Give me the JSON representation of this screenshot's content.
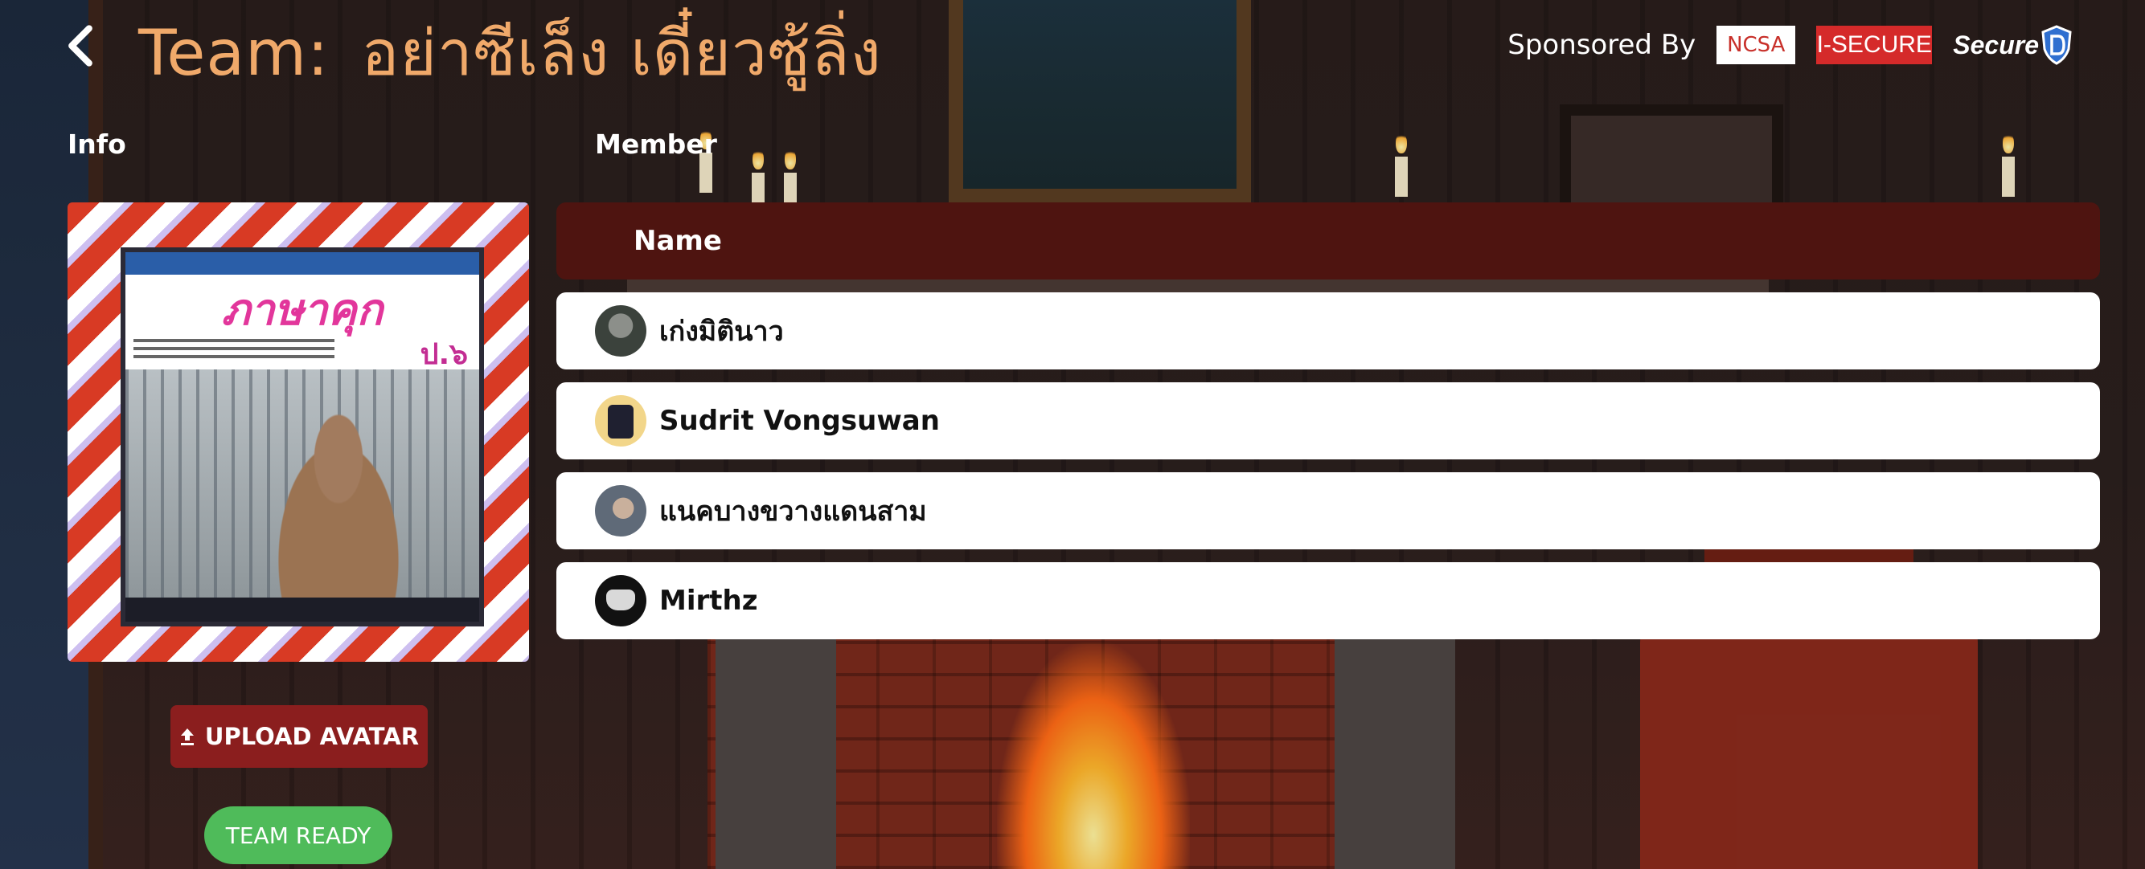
{
  "header": {
    "title_prefix": "Team:",
    "team_name": "อย่าซีเล็ง เดี๋ยวซู้ลิ่ง",
    "sponsor_label": "Sponsored By",
    "sponsors": [
      "NCSA",
      "I-SECURE",
      "Secure"
    ]
  },
  "info": {
    "label": "Info",
    "avatar": {
      "cover_title": "ภาษาคุก",
      "cover_grade": "ป.๖"
    },
    "upload_button": "UPLOAD AVATAR",
    "ready_button": "TEAM READY"
  },
  "members": {
    "label": "Member",
    "column_header": "Name",
    "rows": [
      {
        "name": "เก่งมิตินาว"
      },
      {
        "name": "Sudrit Vongsuwan"
      },
      {
        "name": "แนคบางขวางแดนสาม"
      },
      {
        "name": "Mirthz"
      }
    ]
  },
  "colors": {
    "title": "#f0a96a",
    "table_header": "#4e1410",
    "upload_button": "#8b1e1e",
    "ready_button": "#4fbb5a"
  }
}
